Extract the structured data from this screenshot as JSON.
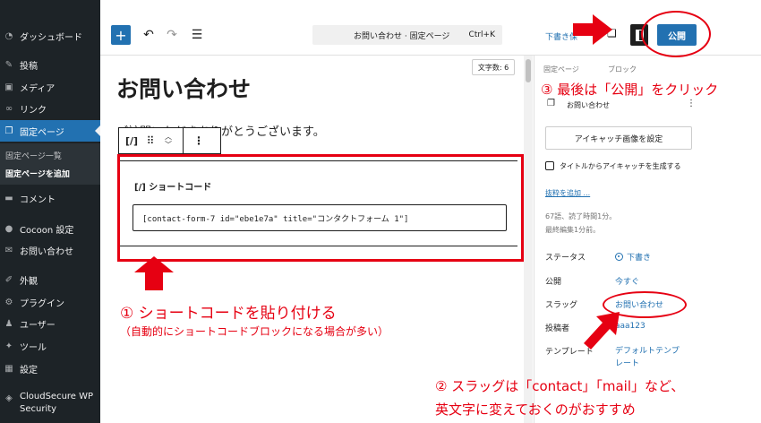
{
  "sidebar": {
    "items": [
      {
        "label": "ダッシュボード",
        "icon": "dashboard-icon"
      },
      {
        "label": "投稿",
        "icon": "pin-icon"
      },
      {
        "label": "メディア",
        "icon": "media-icon"
      },
      {
        "label": "リンク",
        "icon": "link-icon"
      },
      {
        "label": "固定ページ",
        "icon": "pages-icon"
      },
      {
        "label": "コメント",
        "icon": "comment-icon"
      },
      {
        "label": "Cocoon 設定",
        "icon": "cocoon-icon"
      },
      {
        "label": "お問い合わせ",
        "icon": "mail-icon"
      },
      {
        "label": "外観",
        "icon": "appearance-icon"
      },
      {
        "label": "プラグイン",
        "icon": "plugin-icon"
      },
      {
        "label": "ユーザー",
        "icon": "user-icon"
      },
      {
        "label": "ツール",
        "icon": "tool-icon"
      },
      {
        "label": "設定",
        "icon": "settings-icon"
      },
      {
        "label": "CloudSecure WP",
        "label2": "Security",
        "icon": "cloudsecure-icon"
      }
    ],
    "subitems": [
      "固定ページ一覧",
      "固定ページを追加"
    ]
  },
  "topbar": {
    "add_label": "+",
    "doc_title": "お問い合わせ · 固定ページ",
    "shortcut": "Ctrl+K",
    "draft_label": "下書き保",
    "publish_label": "公開"
  },
  "editor": {
    "word_count": "文字数: 6",
    "page_title": "お問い合わせ",
    "paragraph": "ご訪問いただきありがとうございます。",
    "block_toolbar_icon": "[/]",
    "block_label": "[/] ショートコード",
    "shortcode_value": "[contact-form-7 id=\"ebe1e7a\" title=\"コンタクトフォーム 1\"]"
  },
  "panel": {
    "tab_page": "固定ページ",
    "tab_block": "ブロック",
    "page_row": "お問い合わせ",
    "eyecatch_button": "アイキャッチ画像を設定",
    "eyecatch_checkbox": "タイトルからアイキャッチを生成する",
    "excerpt_link": "抜粋を追加 ...",
    "words_read": "67語、読了時間1分。",
    "last_edited": "最終編集1分前。",
    "rows": [
      {
        "label": "ステータス",
        "value": "下書き"
      },
      {
        "label": "公開",
        "value": "今すぐ"
      },
      {
        "label": "スラッグ",
        "value": "お問い合わせ"
      },
      {
        "label": "投稿者",
        "value": "aaa123"
      },
      {
        "label": "テンプレート",
        "value": "デフォルトテンプ",
        "value2": "レート"
      }
    ]
  },
  "annotations": {
    "step1_title": "① ショートコードを貼り付ける",
    "step1_note": "（自動的にショートコードブロックになる場合が多い）",
    "step2_line1": "② スラッグは「contact」「mail」など、",
    "step2_line2": "英文字に変えておくのがおすすめ",
    "step3": "③ 最後は「公開」をクリック"
  },
  "colors": {
    "accent": "#2271b1",
    "annotation": "#e60012",
    "sidebar_bg": "#1d2327"
  }
}
